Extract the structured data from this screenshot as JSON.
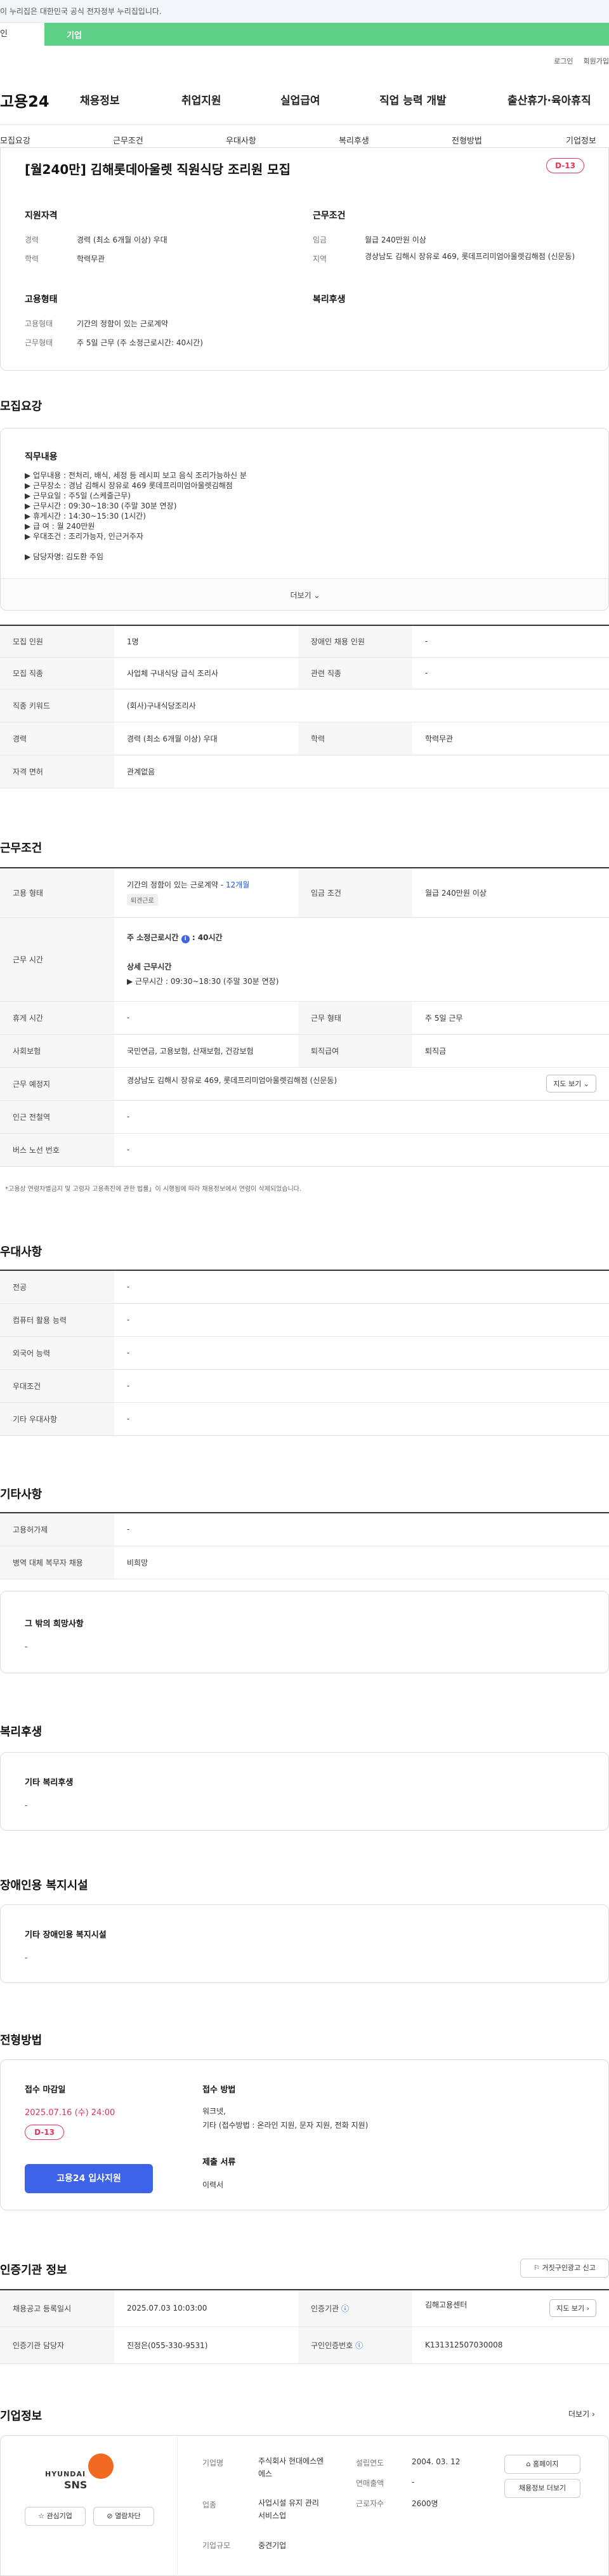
{
  "gov_banner": "이 누리집은 대한민국 공식 전자정부 누리집입니다.",
  "top_strip": {
    "left": "인",
    "bar": "기업"
  },
  "util": [
    "로그인",
    "회원가입"
  ],
  "logo": "고용24",
  "gnb": [
    "채용정보",
    "취업지원",
    "실업급여",
    "직업 능력 개발",
    "출산휴가·육아휴직"
  ],
  "tabs": [
    "모집요강",
    "근무조건",
    "우대사항",
    "복리후생",
    "전형방법",
    "기업정보"
  ],
  "job": {
    "title": "[월240만] 김해롯데아울렛 직원식당 조리원 모집",
    "dday": "D-13",
    "qual_title": "지원자격",
    "cond_title": "근무조건",
    "emp_title": "고용형태",
    "welfare_title": "복리후생",
    "qual": [
      {
        "k": "경력",
        "v": "경력 (최소 6개월 이상) 우대"
      },
      {
        "k": "학력",
        "v": "학력무관"
      }
    ],
    "cond": [
      {
        "k": "임금",
        "v": "월급 240만원 이상"
      },
      {
        "k": "지역",
        "v": "경상남도 김해시 장유로 469, 롯데프리미엄아울렛김해점 (신문동)"
      }
    ],
    "emp": [
      {
        "k": "고용형태",
        "v": "기간의 정함이 있는 근로계약"
      },
      {
        "k": "근무형태",
        "v": "주 5일 근무 (주 소정근로시간: 40시간)"
      }
    ]
  },
  "recruit": {
    "title": "모집요강",
    "detail_title": "직무내용",
    "lines": [
      "▶ 업무내용 : 전처리, 배식, 세정 등 레시피 보고 음식 조리가능하신 분",
      "▶ 근무장소 : 경남 김해시 장유로 469 롯데프리미엄아울렛김해점",
      "▶ 근무요일 : 주5일 (스케줄근무)",
      "▶ 근무시간 : 09:30~18:30 (주말 30분 연장)",
      "▶ 휴게시간 : 14:30~15:30 (1시간)",
      "▶ 급 여 : 월 240만원",
      "▶ 우대조건 : 조리가능자, 인근거주자",
      "",
      "▶ 담당자명: 김도환 주임"
    ],
    "more": "더보기",
    "table": [
      [
        "모집 인원",
        "1명",
        "장애인 채용 인원",
        "-"
      ],
      [
        "모집 직종",
        "사업체 구내식당 급식 조리사",
        "관련 직종",
        "-"
      ],
      [
        "직종 키워드",
        "(회사)구내식당조리사",
        "",
        ""
      ],
      [
        "경력",
        "경력 (최소 6개월 이상) 우대",
        "학력",
        "학력무관"
      ],
      [
        "자격 면허",
        "관계없음",
        "",
        ""
      ]
    ]
  },
  "work": {
    "title": "근무조건",
    "emp_k": "고용 형태",
    "emp_v": "기간의 정함이 있는 근로계약 - ",
    "emp_months": "12개월",
    "emp_tag": "퇴겐근로",
    "wage_k": "임금 조건",
    "wage_v": "월급 240만원 이상",
    "time_k": "근무 시간",
    "time_l1": "주 소정근로시간",
    "time_l1v": ": 40시간",
    "time_detail": "상세 근무시간",
    "time_detail_v": "▶ 근무시간 : 09:30~18:30 (주말 30분 연장)",
    "rows": [
      [
        "휴게 시간",
        "-",
        "근무 형태",
        "주 5일 근무"
      ],
      [
        "사회보험",
        "국민연금, 고용보험, 산재보험, 건강보험",
        "퇴직급여",
        "퇴직금"
      ]
    ],
    "place_k": "근무 예정지",
    "place_v": "경상남도 김해시 장유로 469, 롯데프리미엄아울렛김해점 (신문동)",
    "map_btn": "지도 보기",
    "extra": [
      [
        "인근 전철역",
        "-"
      ],
      [
        "버스 노선 번호",
        "-"
      ]
    ],
    "notice": "*고용상 연령차별금지 및 고령자 고용촉진에 관한 법률」이 시행됨에 따라 채용정보에서 연령이 삭제되었습니다."
  },
  "prefer": {
    "title": "우대사항",
    "rows": [
      [
        "전공",
        "-"
      ],
      [
        "컴퓨터 활용 능력",
        "-"
      ],
      [
        "외국어 능력",
        "-"
      ],
      [
        "우대조건",
        "-"
      ],
      [
        "기타 우대사항",
        "-"
      ]
    ]
  },
  "etc": {
    "title": "기타사항",
    "rows": [
      [
        "고용허가제",
        "-"
      ],
      [
        "병역 대체 복무자 채용",
        "비희망"
      ]
    ],
    "box_title": "그 밖의 희망사항",
    "box_val": "-"
  },
  "welfare": {
    "title": "복리후생",
    "box_title": "기타 복리후생",
    "box_val": "-"
  },
  "disabled": {
    "title": "장애인용 복지시설",
    "box_title": "기타 장애인용 복지시설",
    "box_val": "-"
  },
  "process": {
    "title": "전형방법",
    "deadline_k": "접수 마감일",
    "deadline_v": "2025.07.16 (수) 24:00",
    "dday": "D-13",
    "apply_btn": "고용24 입사지원",
    "method_k": "접수 방법",
    "method_v1": "워크넷,",
    "method_v2": "기타 (접수방법 : 온라인 지원, 문자 지원, 전화 지원)",
    "docs_k": "제출 서류",
    "docs_v": "이력서"
  },
  "agency": {
    "title": "인증기관 정보",
    "report_btn": "거짓구인광고 신고",
    "rows": [
      [
        "채용공고 등록일시",
        "2025.07.03 10:03:00",
        "인증기관",
        "김해고용센터"
      ],
      [
        "인증기관 담당자",
        "진정은(055-330-9531)",
        "구인인증번호",
        "K131312507030008"
      ]
    ],
    "map_btn": "지도 보기"
  },
  "company": {
    "title": "기업정보",
    "more": "더보기",
    "logo_top": "HYUNDAI",
    "logo_bottom": "SNS",
    "fav": "관심기업",
    "block": "열람차단",
    "info": [
      [
        "기업명",
        "주식회사 현대에스엔에스"
      ],
      [
        "업종",
        "사업시설 유지 관리 서비스업"
      ],
      [
        "기업규모",
        "중견기업"
      ]
    ],
    "info2": [
      [
        "설립연도",
        "2004. 03. 12"
      ],
      [
        "연매출액",
        "-"
      ],
      [
        "근로자수",
        "2600명"
      ]
    ],
    "home_btn": "홈페이지",
    "jobs_btn": "채용정보 더보기"
  }
}
